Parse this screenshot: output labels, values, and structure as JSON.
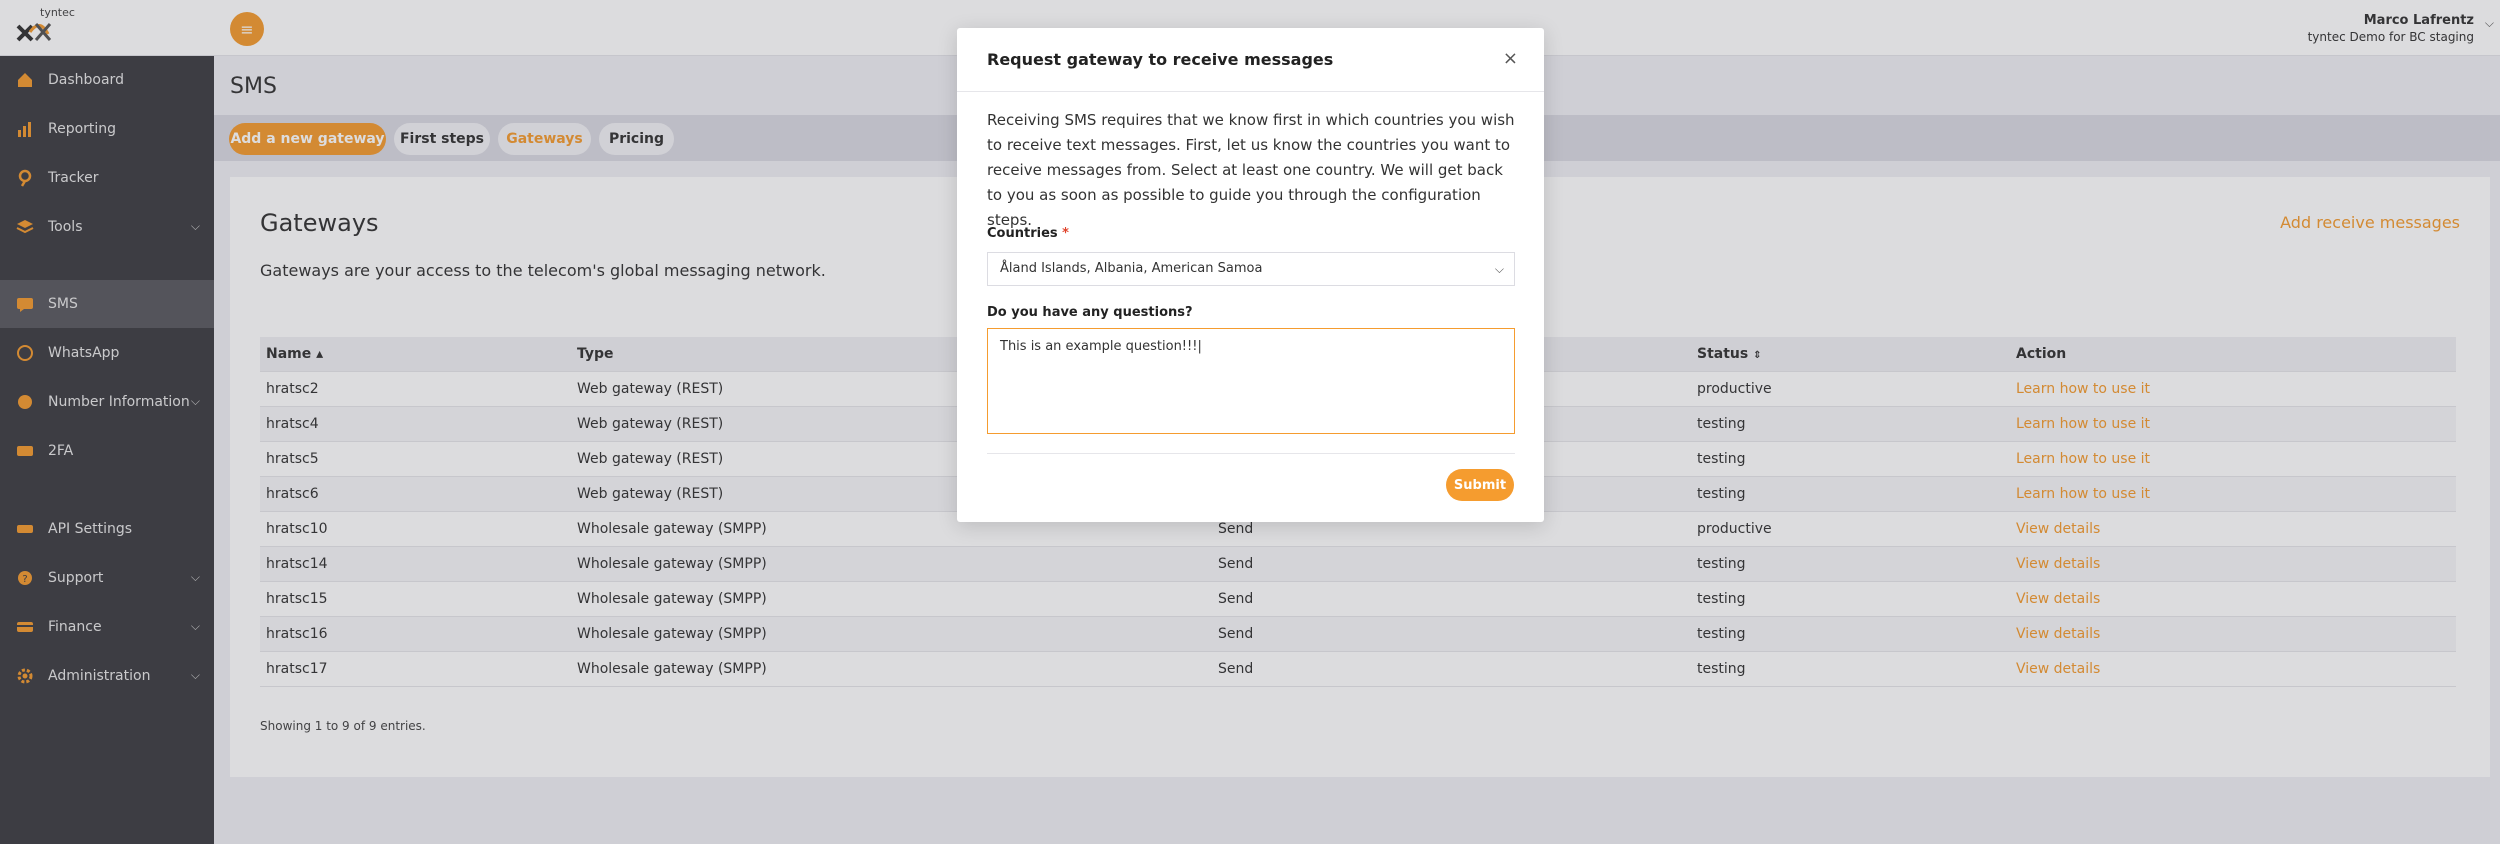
{
  "brand": {
    "name": "tyntec",
    "accent": "#f59c2f"
  },
  "header": {
    "user_name": "Marco Lafrentz",
    "user_org": "tyntec Demo for BC staging"
  },
  "sidebar": {
    "items": [
      {
        "label": "Dashboard",
        "icon": "home-icon"
      },
      {
        "label": "Reporting",
        "icon": "bar-chart-icon"
      },
      {
        "label": "Tracker",
        "icon": "location-pin-icon"
      },
      {
        "label": "Tools",
        "icon": "layers-icon"
      },
      {
        "label": "SMS",
        "icon": "message-icon"
      },
      {
        "label": "WhatsApp",
        "icon": "whatsapp-icon"
      },
      {
        "label": "Number Information",
        "icon": "globe-icon"
      },
      {
        "label": "2FA",
        "icon": "keypad-icon"
      },
      {
        "label": "API Settings",
        "icon": "api-icon"
      },
      {
        "label": "Support",
        "icon": "help-icon"
      },
      {
        "label": "Finance",
        "icon": "card-icon"
      },
      {
        "label": "Administration",
        "icon": "gear-icon"
      }
    ]
  },
  "page": {
    "title": "SMS"
  },
  "tabs": [
    "Add a new gateway",
    "First steps",
    "Gateways",
    "Pricing"
  ],
  "gateways": {
    "title": "Gateways",
    "subtitle": "Gateways are your access to the telecom's global messaging network.",
    "add_link": "Add receive messages",
    "columns": {
      "name": "Name",
      "type": "Type",
      "status": "Status",
      "action": "Action"
    },
    "rows": [
      {
        "name": "hratsc2",
        "type": "Web gateway (REST)",
        "direction": "",
        "status": "productive",
        "action": "Learn how to use it"
      },
      {
        "name": "hratsc4",
        "type": "Web gateway (REST)",
        "direction": "",
        "status": "testing",
        "action": "Learn how to use it"
      },
      {
        "name": "hratsc5",
        "type": "Web gateway (REST)",
        "direction": "",
        "status": "testing",
        "action": "Learn how to use it"
      },
      {
        "name": "hratsc6",
        "type": "Web gateway (REST)",
        "direction": "",
        "status": "testing",
        "action": "Learn how to use it"
      },
      {
        "name": "hratsc10",
        "type": "Wholesale gateway (SMPP)",
        "direction": "Send",
        "status": "productive",
        "action": "View details"
      },
      {
        "name": "hratsc14",
        "type": "Wholesale gateway (SMPP)",
        "direction": "Send",
        "status": "testing",
        "action": "View details"
      },
      {
        "name": "hratsc15",
        "type": "Wholesale gateway (SMPP)",
        "direction": "Send",
        "status": "testing",
        "action": "View details"
      },
      {
        "name": "hratsc16",
        "type": "Wholesale gateway (SMPP)",
        "direction": "Send",
        "status": "testing",
        "action": "View details"
      },
      {
        "name": "hratsc17",
        "type": "Wholesale gateway (SMPP)",
        "direction": "Send",
        "status": "testing",
        "action": "View details"
      }
    ],
    "footer": "Showing 1 to 9 of 9 entries."
  },
  "modal": {
    "title": "Request gateway to receive messages",
    "close_label": "×",
    "description": "Receiving SMS requires that we know first in which countries you wish to receive text messages. First, let us know the countries you want to receive messages from. Select at least one country. We will get back to you as soon as possible to guide you through the configuration steps.",
    "countries_label": "Countries",
    "required_mark": "*",
    "countries_value": "Åland Islands, Albania, American Samoa",
    "questions_label": "Do you have any questions?",
    "questions_value": "This is an example question!!!",
    "submit_label": "Submit"
  }
}
